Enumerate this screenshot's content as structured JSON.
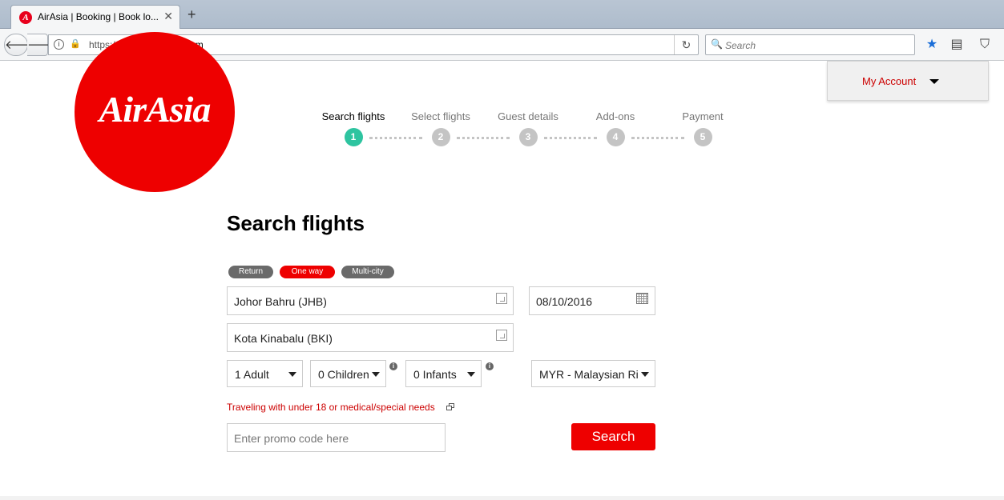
{
  "browser": {
    "tab_title": "AirAsia | Booking | Book lo...",
    "tab_favicon": "A",
    "url_prefix": "https://booking.",
    "url_domain": "airasia.com",
    "search_placeholder": "Search"
  },
  "logo": {
    "text": "AirAsia"
  },
  "account": {
    "label": "My Account"
  },
  "steps": [
    {
      "label": "Search flights",
      "num": "1"
    },
    {
      "label": "Select flights",
      "num": "2"
    },
    {
      "label": "Guest details",
      "num": "3"
    },
    {
      "label": "Add-ons",
      "num": "4"
    },
    {
      "label": "Payment",
      "num": "5"
    }
  ],
  "form": {
    "title": "Search flights",
    "trip_types": [
      "Return",
      "One way",
      "Multi-city"
    ],
    "selected_trip_type": "One way",
    "origin": "Johor Bahru (JHB)",
    "destination": "Kota Kinabalu (BKI)",
    "depart_date": "08/10/2016",
    "adults": "1 Adult",
    "children": "0 Children",
    "infants": "0 Infants",
    "currency": "MYR - Malaysian Ri",
    "special_needs_link": "Traveling with under 18 or medical/special needs",
    "promo_placeholder": "Enter promo code here",
    "search_label": "Search"
  },
  "colors": {
    "brand_red": "#ee0000",
    "active_step": "#2ec4a0"
  }
}
